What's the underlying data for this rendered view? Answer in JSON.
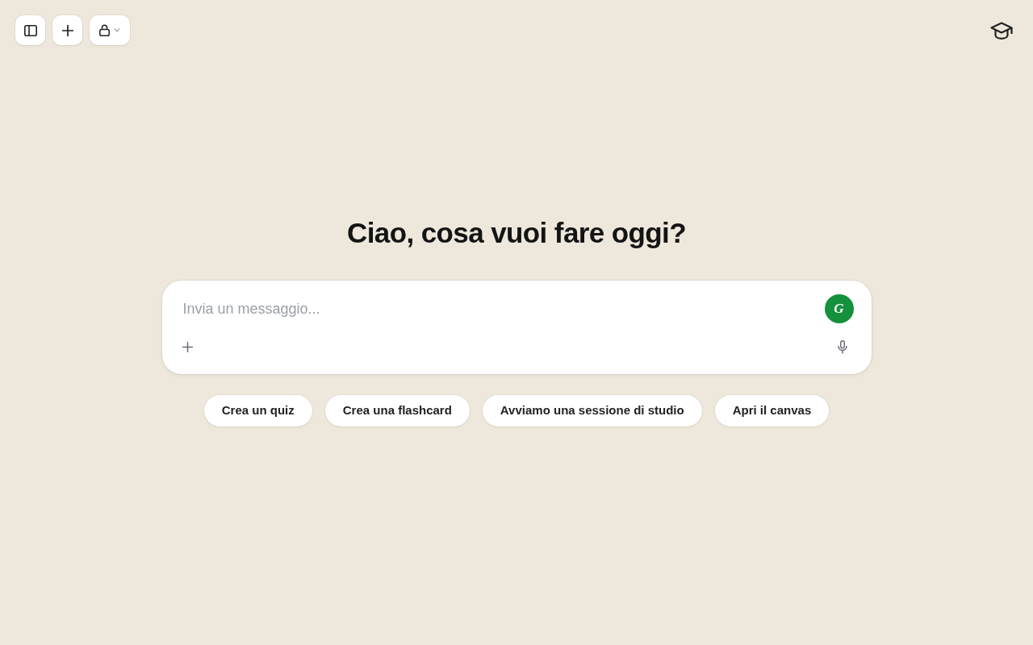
{
  "heading": "Ciao, cosa vuoi fare oggi?",
  "composer": {
    "placeholder": "Invia un messaggio...",
    "assistant_badge": "G"
  },
  "suggestions": [
    "Crea un quiz",
    "Crea una flashcard",
    "Avviamo una sessione di studio",
    "Apri il canvas"
  ]
}
